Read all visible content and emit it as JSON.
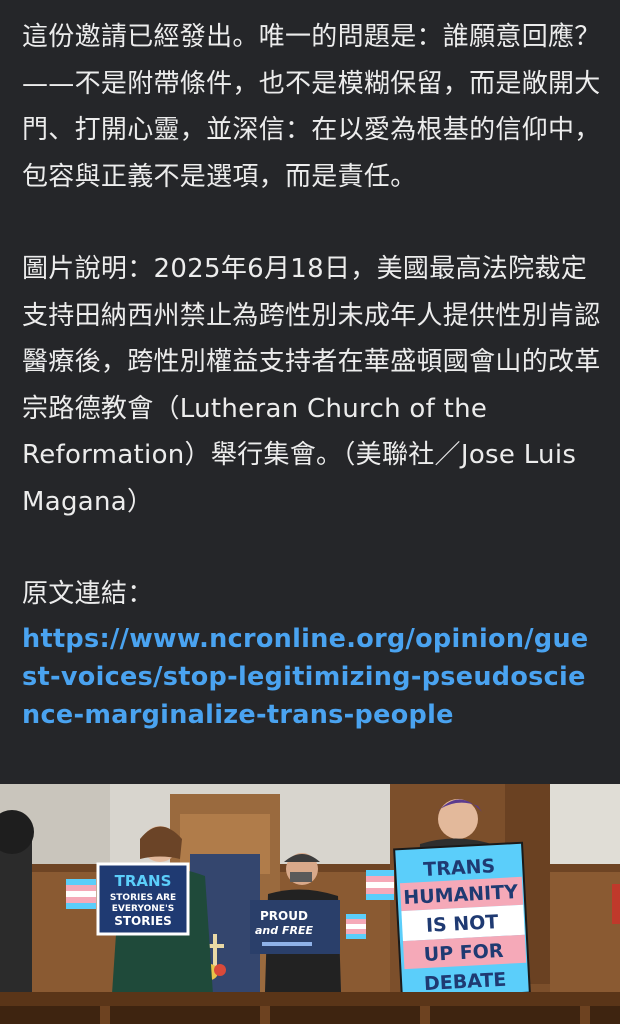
{
  "post": {
    "paragraph1": "這份邀請已經發出。唯一的問題是：誰願意回應？——不是附帶條件，也不是模糊保留，而是敞開大門、打開心靈，並深信：在以愛為根基的信仰中，包容與正義不是選項，而是責任。",
    "paragraph2": "圖片說明：2025年6月18日，美國最高法院裁定支持田納西州禁止為跨性別未成年人提供性別肯認醫療後，跨性別權益支持者在華盛頓國會山的改革宗路德教會（Lutheran Church of the Reformation）舉行集會。（美聯社／Jose Luis Magana）",
    "link_label": "原文連結：",
    "link_url": "https://www.ncronline.org/opinion/guest-voices/stop-legitimizing-pseudoscience-marginalize-trans-people"
  },
  "photo": {
    "sign_left_line1": "TRANS",
    "sign_left_line2": "STORIES ARE",
    "sign_left_line3": "EVERYONE'S",
    "sign_left_line4": "STORIES",
    "sign_center_line1": "PROUD",
    "sign_center_line2": "and FREE",
    "sign_right_line1": "TRANS",
    "sign_right_line2": "HUMANITY",
    "sign_right_line3": "IS NOT",
    "sign_right_line4": "UP FOR",
    "sign_right_line5": "DEBATE",
    "colors": {
      "trans_blue": "#5bcefa",
      "trans_pink": "#f5a9b8",
      "navy": "#1f3a72"
    }
  }
}
